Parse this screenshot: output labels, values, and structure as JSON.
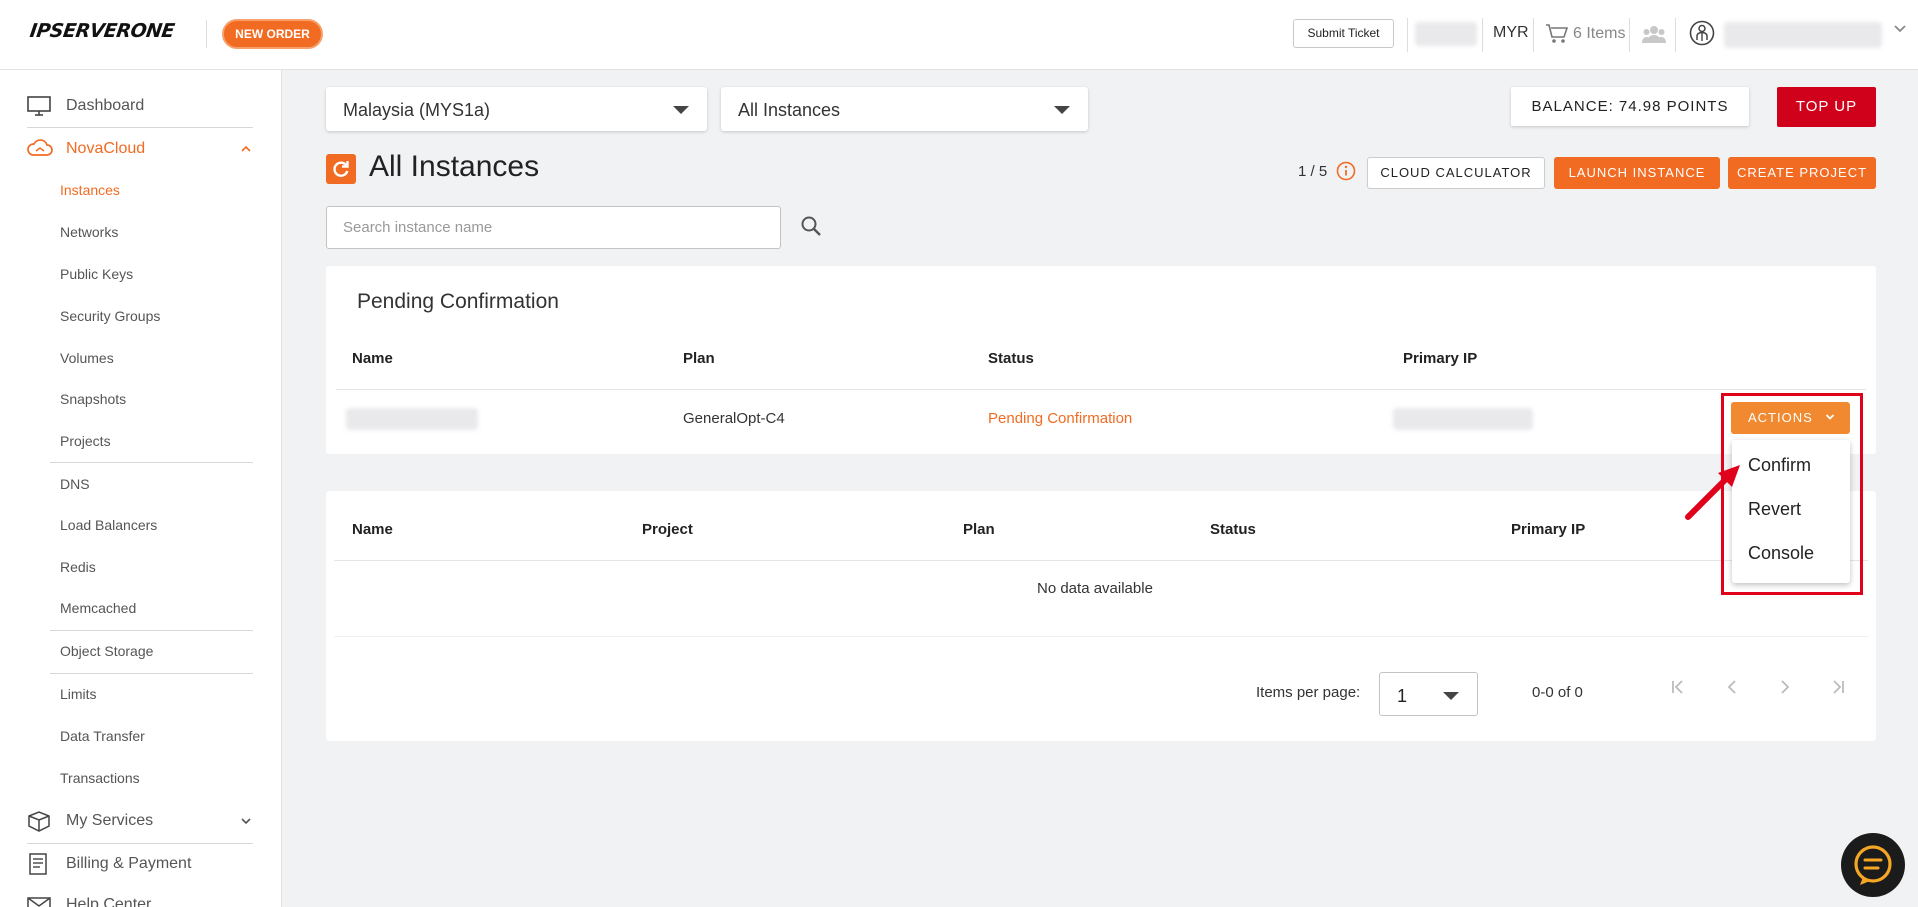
{
  "brand": {
    "logo_text": "IPSERVERONE",
    "accent_color": "#f26b22",
    "topup_color": "#d0021b"
  },
  "header": {
    "new_order_label": "NEW ORDER",
    "submit_ticket_label": "Submit Ticket",
    "currency": "MYR",
    "cart_label": "6 Items"
  },
  "sidebar": {
    "dashboard": "Dashboard",
    "novacloud": "NovaCloud",
    "sub_items": [
      "Instances",
      "Networks",
      "Public Keys",
      "Security Groups",
      "Volumes",
      "Snapshots",
      "Projects",
      "DNS",
      "Load Balancers",
      "Redis",
      "Memcached",
      "Object Storage",
      "Limits",
      "Data Transfer",
      "Transactions"
    ],
    "my_services": "My Services",
    "billing": "Billing & Payment",
    "help_center": "Help Center"
  },
  "filters": {
    "region": "Malaysia (MYS1a)",
    "instances": "All Instances"
  },
  "balance_label": "BALANCE: 74.98 POINTS",
  "topup_label": "TOP UP",
  "page": {
    "title": "All Instances",
    "quota": "1 / 5",
    "cloud_calculator": "CLOUD CALCULATOR",
    "launch_instance": "LAUNCH INSTANCE",
    "create_project": "CREATE PROJECT"
  },
  "search": {
    "placeholder": "Search instance name"
  },
  "pending": {
    "title": "Pending Confirmation",
    "columns": [
      "Name",
      "Plan",
      "Status",
      "Primary IP"
    ],
    "row": {
      "plan": "GeneralOpt-C4",
      "status": "Pending Confirmation"
    },
    "actions_label": "ACTIONS",
    "menu": [
      "Confirm",
      "Revert",
      "Console"
    ]
  },
  "instances_table": {
    "columns": [
      "Name",
      "Project",
      "Plan",
      "Status",
      "Primary IP"
    ],
    "empty": "No data available",
    "items_per_page_label": "Items per page:",
    "items_per_page_value": "1",
    "range": "0-0 of 0"
  }
}
